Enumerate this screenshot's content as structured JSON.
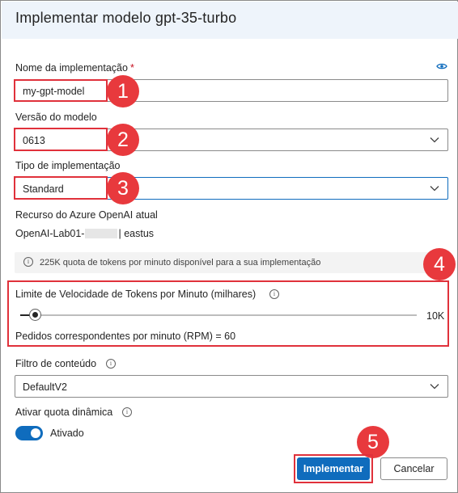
{
  "dialog": {
    "title": "Implementar modelo gpt-35-turbo"
  },
  "deployment_name": {
    "label": "Nome da implementação",
    "required_mark": "*",
    "value": "my-gpt-model",
    "icon": "eye-icon"
  },
  "model_version": {
    "label": "Versão do modelo",
    "value": "0613"
  },
  "deployment_type": {
    "label": "Tipo de implementação",
    "value": "Standard"
  },
  "resource": {
    "label": "Recurso do Azure OpenAI atual",
    "prefix": "OpenAI-Lab01-",
    "suffix": "| eastus"
  },
  "quota_info": {
    "text": "225K quota de tokens por minuto disponível para a sua implementação"
  },
  "rate_limit": {
    "label": "Limite de Velocidade de Tokens por Minuto (milhares)",
    "value_text": "10K",
    "level_fraction": 0.04,
    "rpm_text": "Pedidos correspondentes por minuto (RPM) = 60"
  },
  "content_filter": {
    "label": "Filtro de conteúdo",
    "value": "DefaultV2"
  },
  "dynamic_quota": {
    "label": "Ativar quota dinâmica",
    "state_label": "Ativado",
    "enabled": true
  },
  "actions": {
    "deploy_label": "Implementar",
    "cancel_label": "Cancelar"
  },
  "annotations": {
    "n1": "1",
    "n2": "2",
    "n3": "3",
    "n4": "4",
    "n5": "5"
  },
  "colors": {
    "accent": "#0f6cbd",
    "annotation": "#e8393d",
    "header_bg": "#eef4fb"
  }
}
